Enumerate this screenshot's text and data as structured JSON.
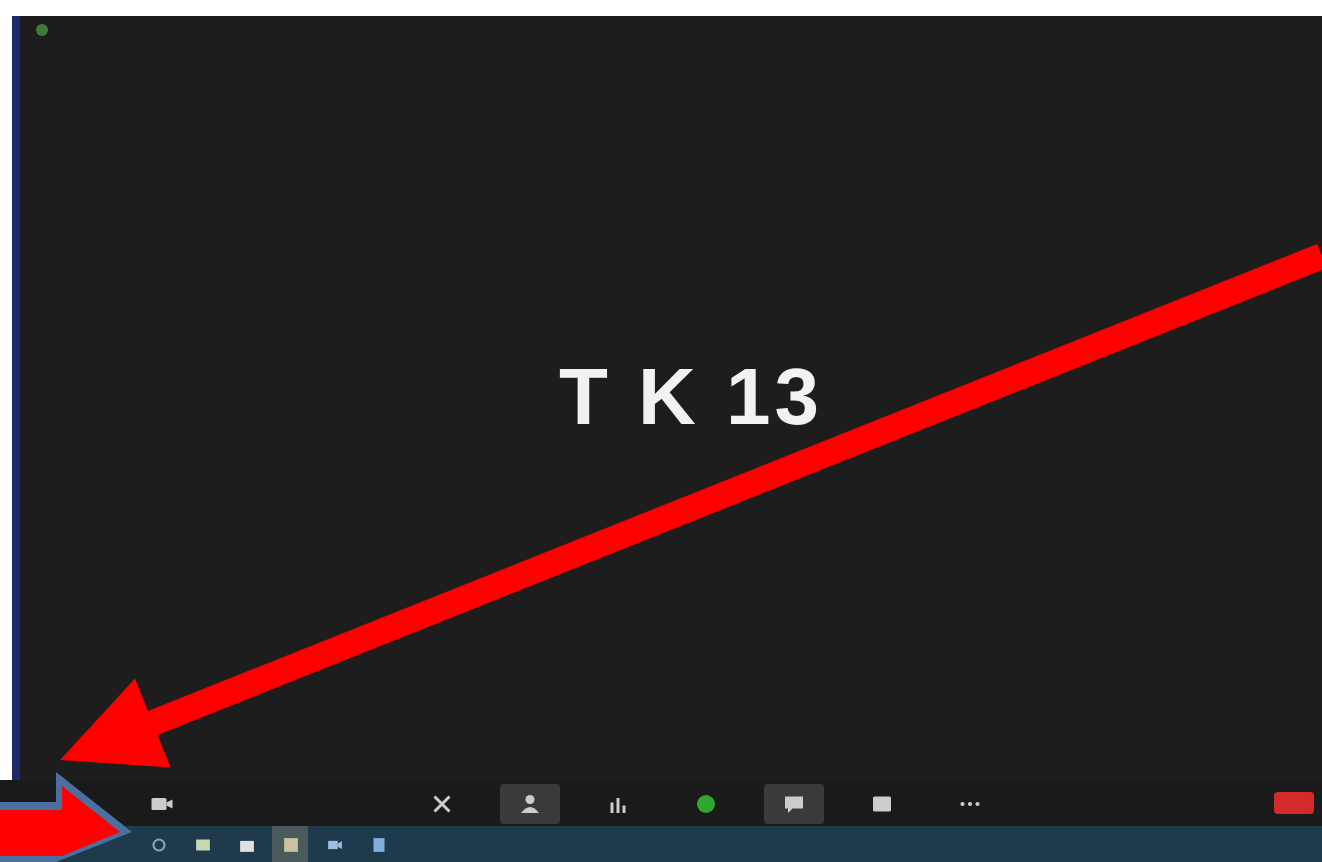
{
  "meeting": {
    "participant_name": "T K 13"
  },
  "toolbar": {
    "left": [
      {
        "kind": "video",
        "selected": false
      }
    ],
    "center": [
      {
        "kind": "share",
        "selected": false
      },
      {
        "kind": "participants",
        "selected": true
      },
      {
        "kind": "polls",
        "selected": false
      },
      {
        "kind": "record",
        "selected": false
      },
      {
        "kind": "chat",
        "selected": true
      },
      {
        "kind": "captions",
        "selected": false
      },
      {
        "kind": "more",
        "selected": false
      }
    ],
    "end": {
      "kind": "end"
    }
  },
  "taskbar": [
    {
      "kind": "search"
    },
    {
      "kind": "film"
    },
    {
      "kind": "bag"
    },
    {
      "kind": "app",
      "selected": true
    },
    {
      "kind": "meet"
    },
    {
      "kind": "doc"
    }
  ]
}
